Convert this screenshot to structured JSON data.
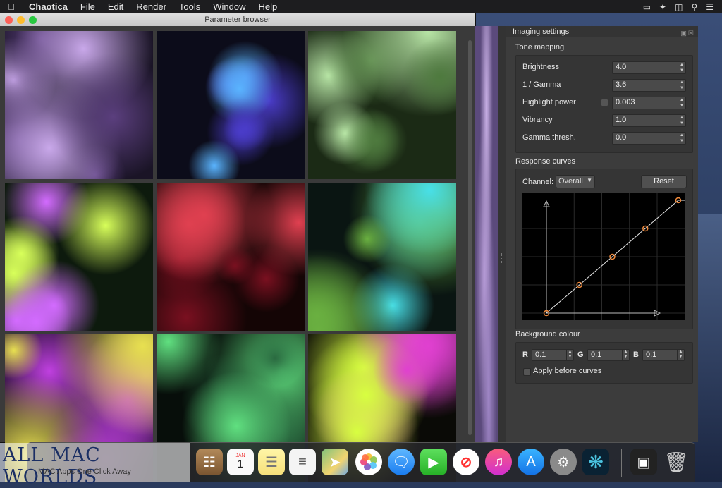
{
  "menubar": {
    "app_name": "Chaotica",
    "items": [
      "File",
      "Edit",
      "Render",
      "Tools",
      "Window",
      "Help"
    ]
  },
  "browser": {
    "title": "Parameter browser",
    "thumbnails": [
      {
        "palette": [
          "#c9a8ea",
          "#5b3f7e",
          "#1a1426"
        ]
      },
      {
        "palette": [
          "#5ab4ff",
          "#4a3cc9",
          "#0c0c1a"
        ]
      },
      {
        "palette": [
          "#b8e6a6",
          "#4e7a3e",
          "#1b2a15"
        ]
      },
      {
        "palette": [
          "#d8ff5a",
          "#d36bff",
          "#0d1a0d"
        ]
      },
      {
        "palette": [
          "#e04050",
          "#7a1020",
          "#140505"
        ]
      },
      {
        "palette": [
          "#48e0e8",
          "#6ab040",
          "#0a1512"
        ]
      },
      {
        "palette": [
          "#c040e0",
          "#e8e050",
          "#10081a"
        ]
      },
      {
        "palette": [
          "#60e080",
          "#2a6a40",
          "#070e0a"
        ]
      },
      {
        "palette": [
          "#d8ff40",
          "#e040d0",
          "#0a0a06"
        ]
      }
    ]
  },
  "panel": {
    "title": "Imaging settings",
    "tone_mapping": {
      "label": "Tone mapping",
      "brightness": {
        "label": "Brightness",
        "value": "4.0"
      },
      "gamma": {
        "label": "1 / Gamma",
        "value": "3.6"
      },
      "highlight": {
        "label": "Highlight power",
        "value": "0.003"
      },
      "vibrancy": {
        "label": "Vibrancy",
        "value": "1.0"
      },
      "gamma_thresh": {
        "label": "Gamma thresh.",
        "value": "0.0"
      }
    },
    "response_curves": {
      "label": "Response curves",
      "channel_label": "Channel:",
      "channel_value": "Overall",
      "reset_label": "Reset",
      "points": [
        [
          0.0,
          0.0
        ],
        [
          0.25,
          0.25
        ],
        [
          0.5,
          0.5
        ],
        [
          0.75,
          0.75
        ],
        [
          1.0,
          1.0
        ]
      ]
    },
    "background": {
      "label": "Background colour",
      "r_label": "R",
      "r_value": "0.1",
      "g_label": "G",
      "g_value": "0.1",
      "b_label": "B",
      "b_value": "0.1",
      "apply_label": "Apply before curves"
    }
  },
  "watermark": {
    "title": "ALL MAC WORLDS",
    "subtitle": "MAC Apps One Click Away"
  },
  "dock": {
    "calendar_month": "JAN",
    "calendar_day": "1"
  }
}
